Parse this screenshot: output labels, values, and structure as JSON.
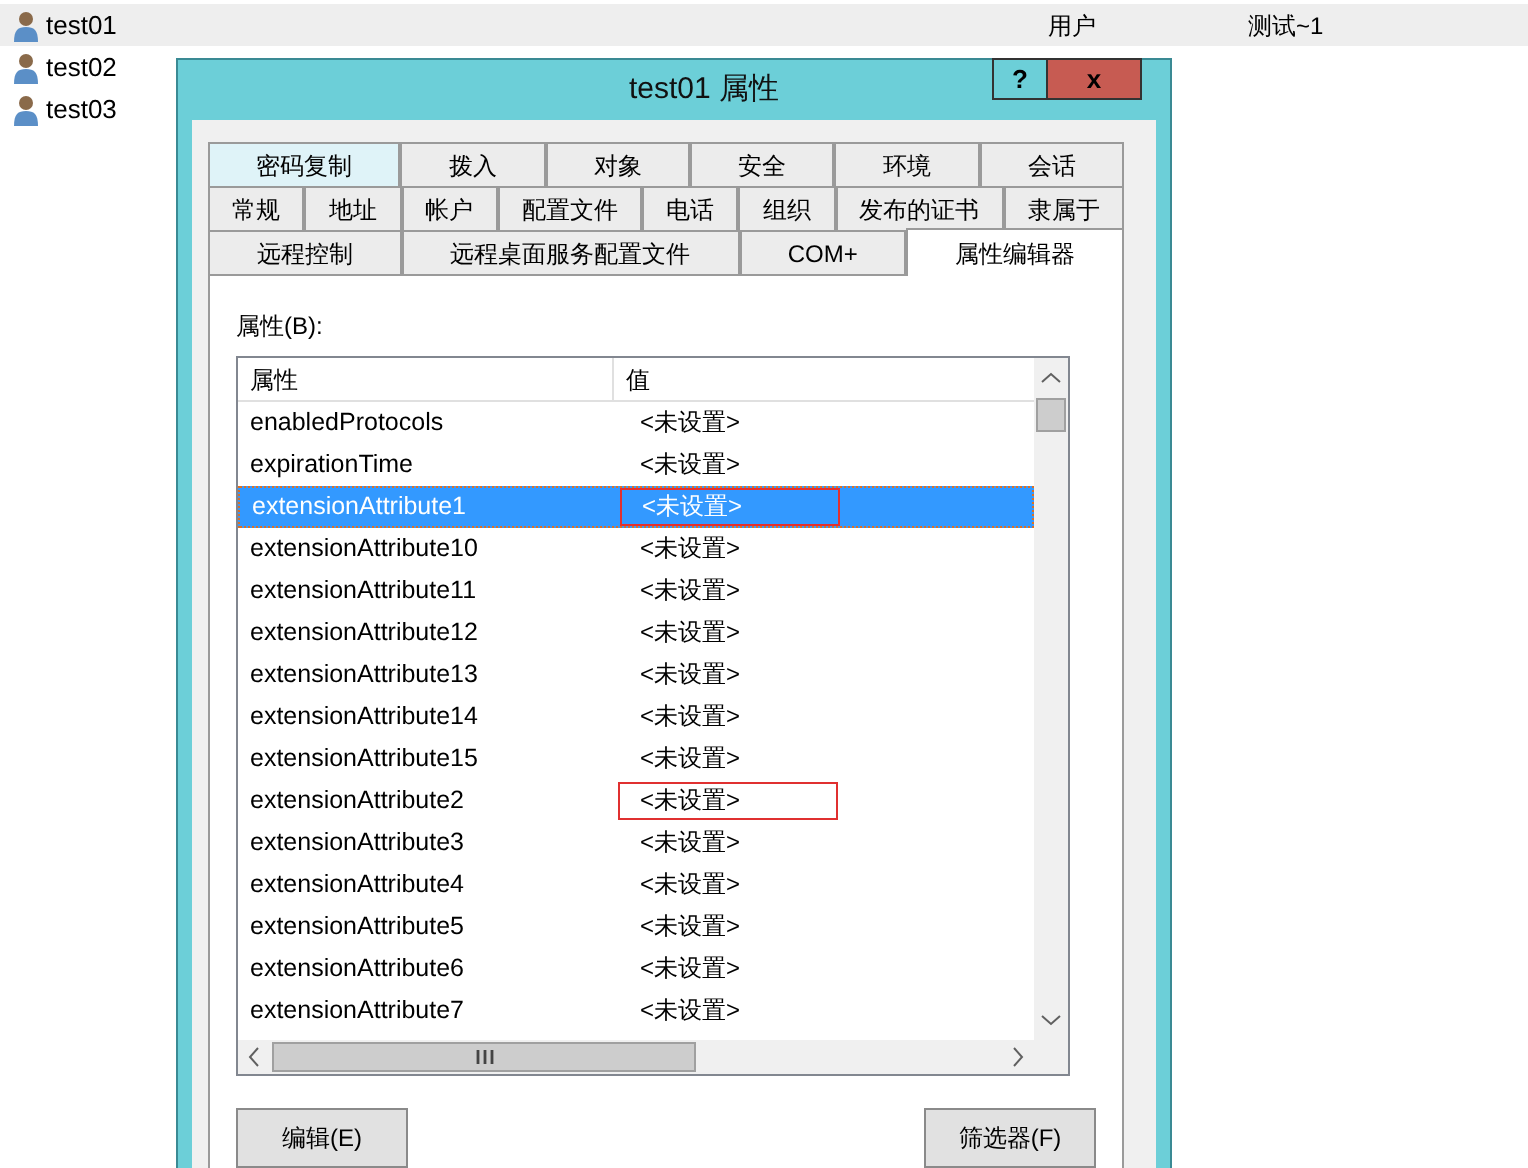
{
  "background_list": {
    "rows": [
      {
        "name": "test01",
        "type": "用户",
        "description": "测试~1",
        "selected": true
      },
      {
        "name": "test02",
        "selected": false
      },
      {
        "name": "test03",
        "selected": false
      }
    ]
  },
  "dialog": {
    "title": "test01 属性",
    "help_button": "?",
    "close_button": "x",
    "tab_rows": [
      [
        {
          "label": "密码复制",
          "selected": false,
          "focused": true
        },
        {
          "label": "拨入",
          "selected": false,
          "focused": false
        },
        {
          "label": "对象",
          "selected": false,
          "focused": false
        },
        {
          "label": "安全",
          "selected": false,
          "focused": false
        },
        {
          "label": "环境",
          "selected": false,
          "focused": false
        },
        {
          "label": "会话",
          "selected": false,
          "focused": false
        }
      ],
      [
        {
          "label": "常规",
          "selected": false,
          "focused": false
        },
        {
          "label": "地址",
          "selected": false,
          "focused": false
        },
        {
          "label": "帐户",
          "selected": false,
          "focused": false
        },
        {
          "label": "配置文件",
          "selected": false,
          "focused": false
        },
        {
          "label": "电话",
          "selected": false,
          "focused": false
        },
        {
          "label": "组织",
          "selected": false,
          "focused": false
        },
        {
          "label": "发布的证书",
          "selected": false,
          "focused": false
        },
        {
          "label": "隶属于",
          "selected": false,
          "focused": false
        }
      ],
      [
        {
          "label": "远程控制",
          "selected": false,
          "focused": false
        },
        {
          "label": "远程桌面服务配置文件",
          "selected": false,
          "focused": false
        },
        {
          "label": "COM+",
          "selected": false,
          "focused": false
        },
        {
          "label": "属性编辑器",
          "selected": true,
          "focused": false
        }
      ]
    ],
    "attributes_label": "属性(B):",
    "table": {
      "columns": [
        "属性",
        "值"
      ],
      "rows": [
        {
          "attribute": "enabledProtocols",
          "value": "<未设置>",
          "selected": false,
          "annotated": false
        },
        {
          "attribute": "expirationTime",
          "value": "<未设置>",
          "selected": false,
          "annotated": false
        },
        {
          "attribute": "extensionAttribute1",
          "value": "<未设置>",
          "selected": true,
          "annotated": true
        },
        {
          "attribute": "extensionAttribute10",
          "value": "<未设置>",
          "selected": false,
          "annotated": false
        },
        {
          "attribute": "extensionAttribute11",
          "value": "<未设置>",
          "selected": false,
          "annotated": false
        },
        {
          "attribute": "extensionAttribute12",
          "value": "<未设置>",
          "selected": false,
          "annotated": false
        },
        {
          "attribute": "extensionAttribute13",
          "value": "<未设置>",
          "selected": false,
          "annotated": false
        },
        {
          "attribute": "extensionAttribute14",
          "value": "<未设置>",
          "selected": false,
          "annotated": false
        },
        {
          "attribute": "extensionAttribute15",
          "value": "<未设置>",
          "selected": false,
          "annotated": false
        },
        {
          "attribute": "extensionAttribute2",
          "value": "<未设置>",
          "selected": false,
          "annotated": true
        },
        {
          "attribute": "extensionAttribute3",
          "value": "<未设置>",
          "selected": false,
          "annotated": false
        },
        {
          "attribute": "extensionAttribute4",
          "value": "<未设置>",
          "selected": false,
          "annotated": false
        },
        {
          "attribute": "extensionAttribute5",
          "value": "<未设置>",
          "selected": false,
          "annotated": false
        },
        {
          "attribute": "extensionAttribute6",
          "value": "<未设置>",
          "selected": false,
          "annotated": false
        },
        {
          "attribute": "extensionAttribute7",
          "value": "<未设置>",
          "selected": false,
          "annotated": false
        }
      ]
    },
    "buttons": [
      "编辑(E)",
      "筛选器(F)"
    ]
  }
}
